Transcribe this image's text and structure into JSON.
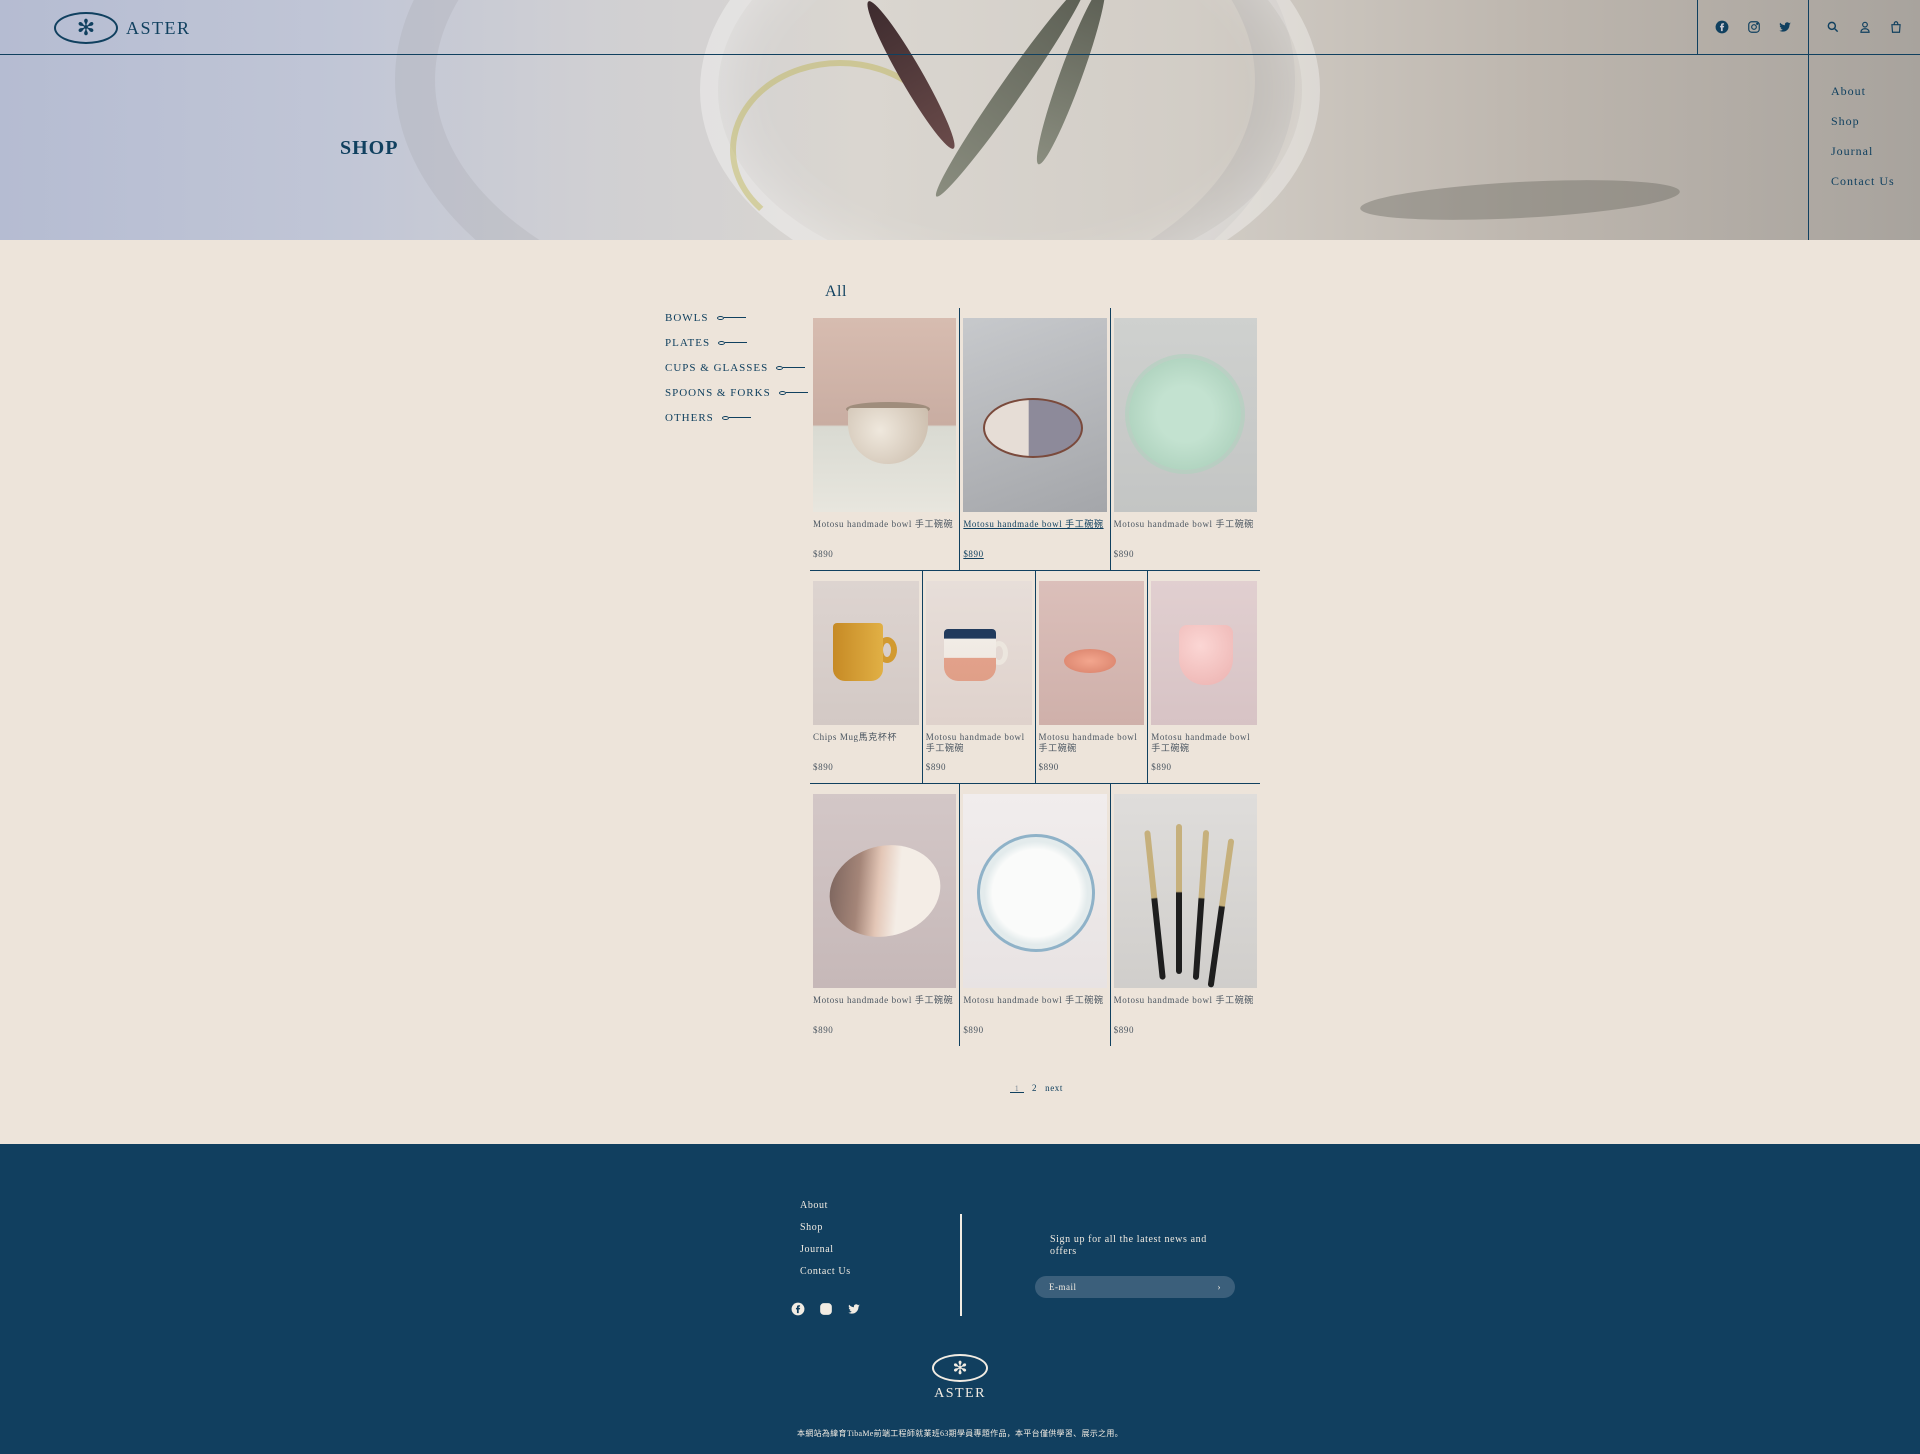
{
  "header": {
    "brand": "ASTER",
    "brand_mark": "✻",
    "social_icons": [
      "facebook-icon",
      "instagram-icon",
      "twitter-icon"
    ],
    "utility_icons": [
      "search-icon",
      "user-icon",
      "cart-icon"
    ],
    "side_nav": [
      "About",
      "Shop",
      "Journal",
      "Contact Us"
    ],
    "hero_title": "SHOP"
  },
  "categories": [
    "BOWLS",
    "PLATES",
    "CUPS & GLASSES",
    "SPOONS & FORKS",
    "OTHERS"
  ],
  "filter_label": "All",
  "products": [
    {
      "name": "Motosu handmade bowl 手工碗碗",
      "price": "$890"
    },
    {
      "name": "Motosu handmade bowl 手工碗碗",
      "price": "$890"
    },
    {
      "name": "Motosu handmade bowl 手工碗碗",
      "price": "$890"
    },
    {
      "name": "Chips Mug馬克杯杯",
      "price": "$890"
    },
    {
      "name": "Motosu handmade bowl 手工碗碗",
      "price": "$890"
    },
    {
      "name": "Motosu handmade bowl 手工碗碗",
      "price": "$890"
    },
    {
      "name": "Motosu handmade bowl 手工碗碗",
      "price": "$890"
    },
    {
      "name": "Motosu handmade bowl 手工碗碗",
      "price": "$890"
    },
    {
      "name": "Motosu handmade bowl 手工碗碗",
      "price": "$890"
    },
    {
      "name": "Motosu handmade bowl 手工碗碗",
      "price": "$890"
    }
  ],
  "pagination": {
    "current": "1",
    "page2": "2",
    "next": "next"
  },
  "footer": {
    "nav": [
      "About",
      "Shop",
      "Journal",
      "Contact Us"
    ],
    "signup_text": "Sign up for all the latest news and offers",
    "email_placeholder": "E-mail",
    "email_submit": "›",
    "brand": "ASTER",
    "brand_mark": "✻",
    "copyright": "本網站為緯育TibaMe前端工程師就業班63期學員專題作品，本平台僅供學習、展示之用。"
  },
  "colors": {
    "navy": "#113f5f",
    "background": "#ede4da",
    "cream": "#f2ece3"
  }
}
